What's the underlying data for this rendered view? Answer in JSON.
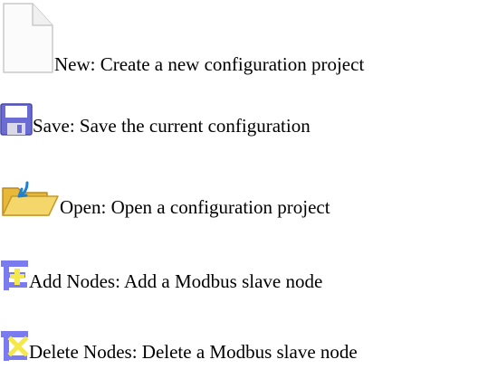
{
  "toolbar_items": [
    {
      "icon": "new-file-icon",
      "label": "New: Create a new configuration project"
    },
    {
      "icon": "save-floppy-icon",
      "label": "Save: Save the current configuration"
    },
    {
      "icon": "open-folder-icon",
      "label": "Open: Open a configuration project"
    },
    {
      "icon": "add-nodes-icon",
      "label": "Add Nodes: Add a Modbus slave node"
    },
    {
      "icon": "delete-nodes-icon",
      "label": "Delete Nodes: Delete a Modbus slave node"
    }
  ],
  "colors": {
    "text": "#000000",
    "save_icon_purple": "#6b6bd6",
    "folder_yellow": "#f0c848",
    "node_icon_blue": "#7b7bf0",
    "node_icon_yellow": "#f5e84a"
  }
}
